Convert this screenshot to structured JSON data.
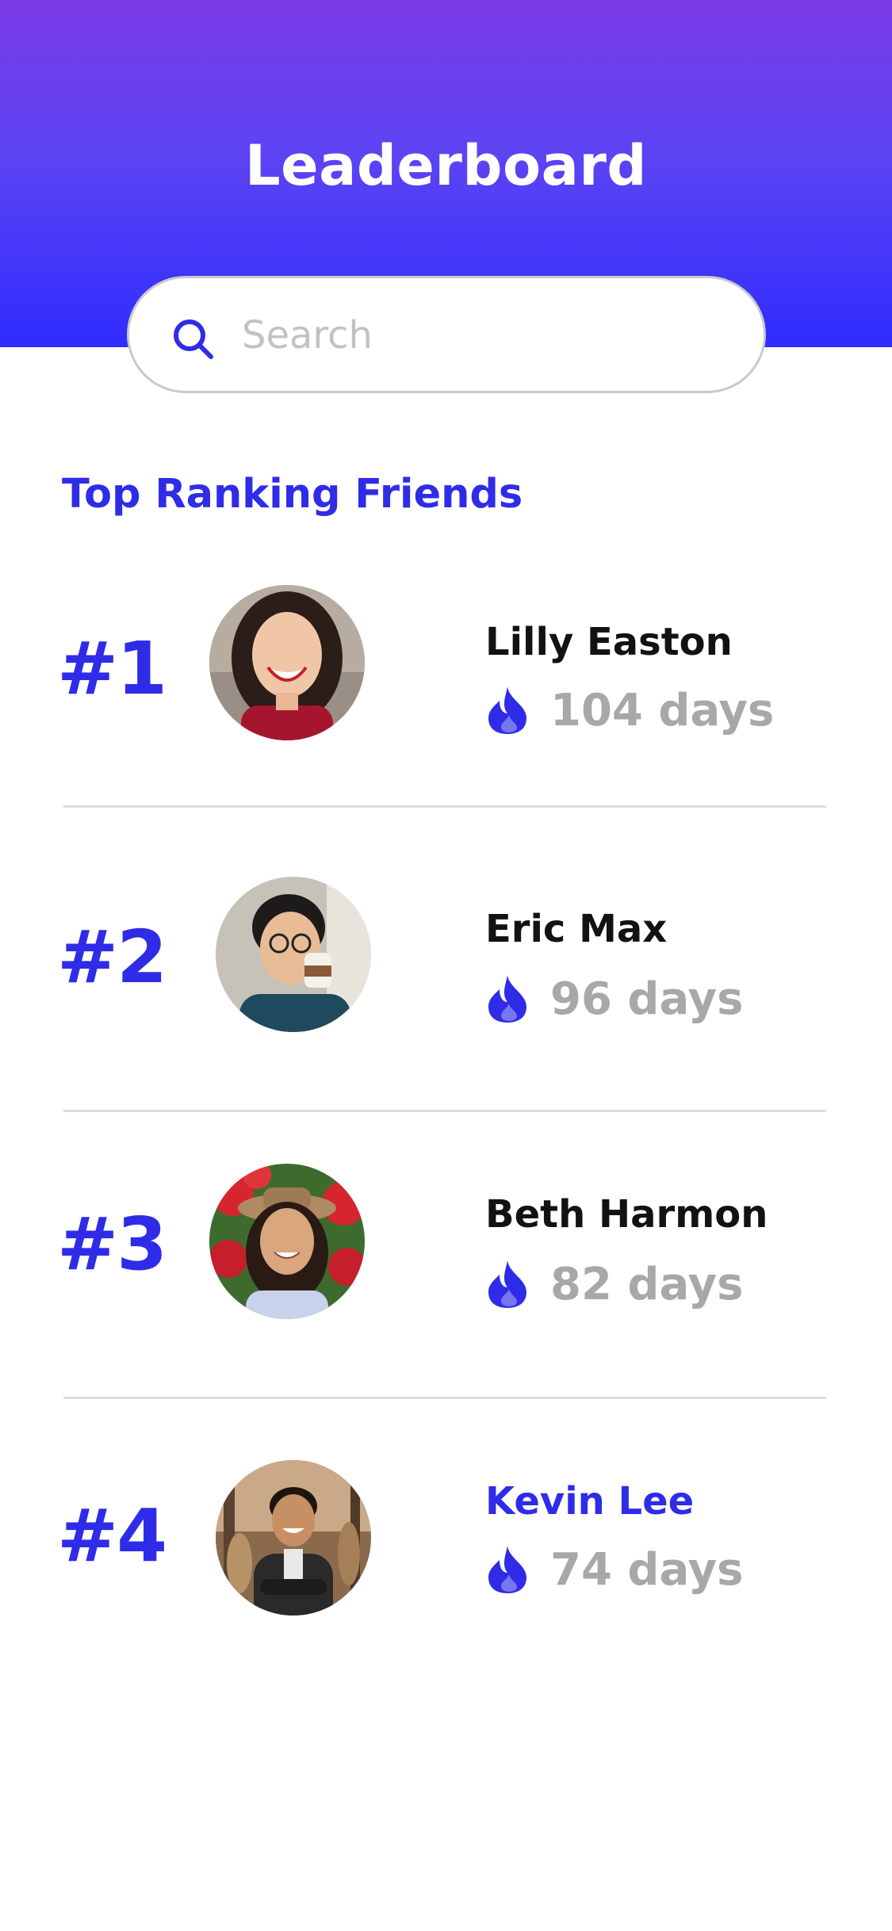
{
  "header": {
    "title": "Leaderboard"
  },
  "search": {
    "placeholder": "Search",
    "icon": "search-icon"
  },
  "section": {
    "title": "Top Ranking Friends"
  },
  "friends": [
    {
      "rank": "#1",
      "name": "Lilly Easton",
      "streak": "104 days",
      "highlighted": false
    },
    {
      "rank": "#2",
      "name": "Eric Max",
      "streak": "96 days",
      "highlighted": false
    },
    {
      "rank": "#3",
      "name": "Beth Harmon",
      "streak": "82 days",
      "highlighted": false
    },
    {
      "rank": "#4",
      "name": "Kevin Lee",
      "streak": "74 days",
      "highlighted": true
    }
  ],
  "colors": {
    "accent": "#2f2ce8",
    "gradient_top": "#7a3be6",
    "gradient_bottom": "#2f2cff",
    "muted_text": "#a8a8a8"
  }
}
